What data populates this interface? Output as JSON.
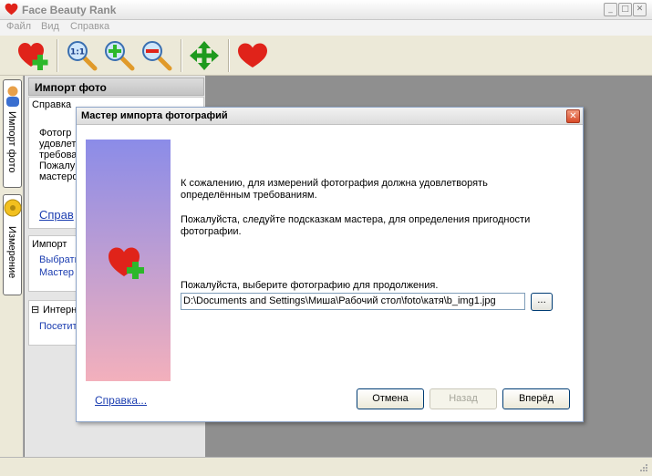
{
  "window": {
    "title": "Face Beauty Rank",
    "controls": {
      "minimize": "_",
      "maximize": "□",
      "close": "✕"
    }
  },
  "menubar": {
    "items": [
      "Файл",
      "Вид",
      "Справка"
    ]
  },
  "toolbar": {
    "buttons": [
      {
        "name": "add-photo",
        "icon": "heart-plus-icon"
      },
      {
        "name": "zoom-actual",
        "icon": "zoom-1to1-icon",
        "label": "1:1"
      },
      {
        "name": "zoom-in",
        "icon": "zoom-in-icon"
      },
      {
        "name": "zoom-out",
        "icon": "zoom-out-icon"
      },
      {
        "name": "move",
        "icon": "move-arrows-icon"
      },
      {
        "name": "rank",
        "icon": "heart-icon"
      }
    ]
  },
  "left_tabs": [
    {
      "label": "Импорт фото",
      "icon": "person-icon"
    },
    {
      "label": "Измерение",
      "icon": "tape-measure-icon"
    }
  ],
  "left_panel": {
    "title": "Импорт фото",
    "help_section": {
      "title": "Справка",
      "text_lines": [
        "Фотогр",
        "удовлет",
        "требова",
        "Пожалуй",
        "мастеро"
      ],
      "link": "Справ"
    },
    "import_section": {
      "title": "Импорт",
      "links": [
        "Выбрать",
        "Мастер"
      ]
    },
    "internet_section": {
      "toggle": "⊟",
      "title": "Интерн",
      "links": [
        "Посетит"
      ]
    }
  },
  "dialog": {
    "title": "Мастер импорта фотографий",
    "close": "✕",
    "intro_line1": "К сожалению, для измерений  фотография должна удовлетворять",
    "intro_line2": "определённым требованиям.",
    "instr_line1": "Пожалуйста, следуйте подсказкам мастера, для определения пригодности",
    "instr_line2": "фотографии.",
    "select_label": "Пожалуйста, выберите фотографию для продолжения.",
    "path_value": "D:\\Documents and Settings\\Миша\\Рабочий стол\\foto\\катя\\b_img1.jpg",
    "browse_label": "...",
    "help_link": "Справка...",
    "buttons": {
      "cancel": "Отмена",
      "back": "Назад",
      "next": "Вперёд"
    }
  },
  "colors": {
    "accent_red": "#e0231a",
    "accent_green": "#2db82a",
    "link_blue": "#1b3db0",
    "side_gradient_top": "#8b8ce8",
    "side_gradient_bottom": "#f3b0bc"
  }
}
